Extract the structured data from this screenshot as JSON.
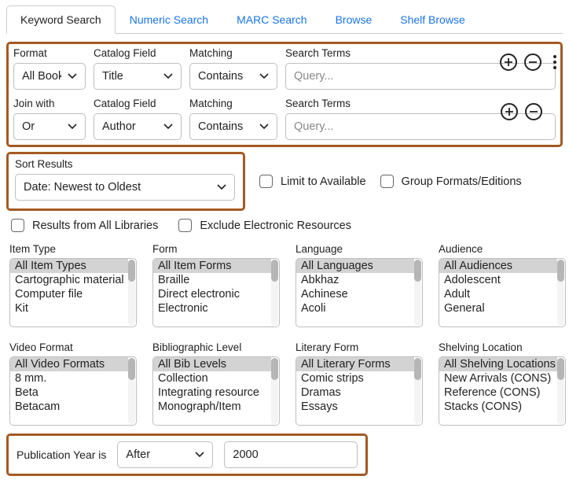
{
  "tabs": [
    {
      "id": "keyword",
      "label": "Keyword Search",
      "active": true
    },
    {
      "id": "numeric",
      "label": "Numeric Search",
      "active": false
    },
    {
      "id": "marc",
      "label": "MARC Search",
      "active": false
    },
    {
      "id": "browse",
      "label": "Browse",
      "active": false
    },
    {
      "id": "shelf",
      "label": "Shelf Browse",
      "active": false
    }
  ],
  "labels": {
    "format": "Format",
    "catalog_field": "Catalog Field",
    "matching": "Matching",
    "search_terms": "Search Terms",
    "join_with": "Join with",
    "sort_results": "Sort Results",
    "item_type": "Item Type",
    "form": "Form",
    "language": "Language",
    "audience": "Audience",
    "video_format": "Video Format",
    "bib_level": "Bibliographic Level",
    "literary_form": "Literary Form",
    "shelving_location": "Shelving Location",
    "pub_year": "Publication Year is"
  },
  "row1": {
    "format": "All Books",
    "field": "Title",
    "matching": "Contains",
    "terms_placeholder": "Query..."
  },
  "row2": {
    "join": "Or",
    "field": "Author",
    "matching": "Contains",
    "terms_placeholder": "Query..."
  },
  "sort": {
    "value": "Date: Newest to Oldest"
  },
  "checkboxes": {
    "limit_available": "Limit to Available",
    "group_formats": "Group Formats/Editions",
    "all_libraries": "Results from All Libraries",
    "exclude_electronic": "Exclude Electronic Resources"
  },
  "facets": {
    "item_type": [
      "All Item Types",
      "Cartographic material",
      "Computer file",
      "Kit"
    ],
    "form": [
      "All Item Forms",
      "Braille",
      "Direct electronic",
      "Electronic"
    ],
    "language": [
      "All Languages",
      "Abkhaz",
      "Achinese",
      "Acoli"
    ],
    "audience": [
      "All Audiences",
      "Adolescent",
      "Adult",
      "General"
    ],
    "video_format": [
      "All Video Formats",
      "8 mm.",
      "Beta",
      "Betacam"
    ],
    "bib_level": [
      "All Bib Levels",
      "Collection",
      "Integrating resource",
      "Monograph/Item"
    ],
    "literary_form": [
      "All Literary Forms",
      "Comic strips",
      "Dramas",
      "Essays"
    ],
    "shelving_location": [
      "All Shelving Locations",
      "New Arrivals (CONS)",
      "Reference (CONS)",
      "Stacks (CONS)"
    ]
  },
  "pub_year": {
    "op": "After",
    "value": "2000"
  }
}
